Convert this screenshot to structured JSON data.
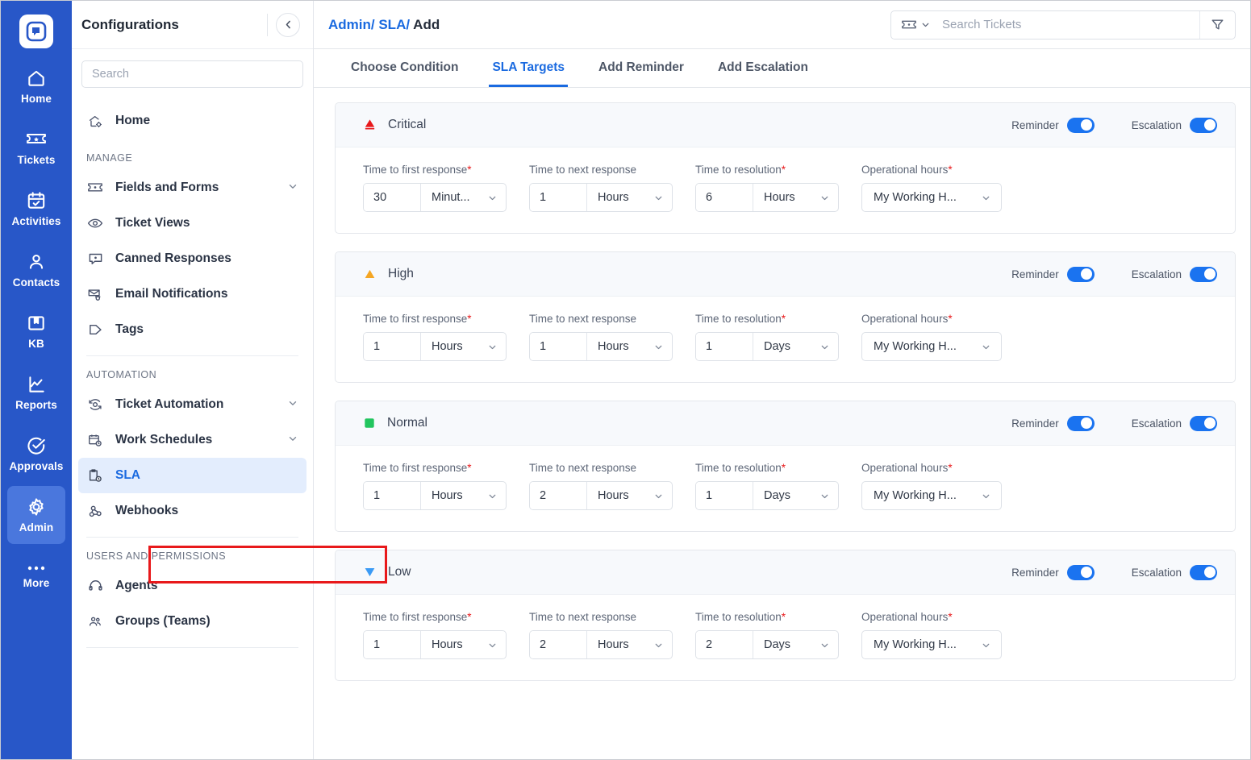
{
  "brand": {
    "logo": "chat-bubble-logo",
    "rail_bg": "#2857c8",
    "accent": "#1a6ae0"
  },
  "rail": {
    "items": [
      {
        "label": "Home",
        "icon": "home-icon",
        "active": false
      },
      {
        "label": "Tickets",
        "icon": "ticket-icon",
        "active": false
      },
      {
        "label": "Activities",
        "icon": "calendar-check-icon",
        "active": false
      },
      {
        "label": "Contacts",
        "icon": "person-icon",
        "active": false
      },
      {
        "label": "KB",
        "icon": "book-icon",
        "active": false
      },
      {
        "label": "Reports",
        "icon": "chart-icon",
        "active": false
      },
      {
        "label": "Approvals",
        "icon": "check-circle-icon",
        "active": false
      },
      {
        "label": "Admin",
        "icon": "gear-icon",
        "active": true
      },
      {
        "label": "More",
        "icon": "ellipsis-icon",
        "active": false
      }
    ]
  },
  "header": {
    "breadcrumb": {
      "admin": "Admin/",
      "sla": "SLA/",
      "current": "Add"
    },
    "search": {
      "placeholder": "Search Tickets",
      "value": "",
      "type_icon": "ticket-icon",
      "filter_icon": "filter-icon"
    }
  },
  "config_panel": {
    "title": "Configurations",
    "collapse_icon": "chevron-left-icon",
    "search": {
      "placeholder": "Search",
      "value": ""
    },
    "home_item": {
      "label": "Home",
      "icon": "home-gear-icon"
    },
    "sections": [
      {
        "label": "MANAGE",
        "items": [
          {
            "label": "Fields and Forms",
            "icon": "ticket-field-icon",
            "expandable": true,
            "selected": false
          },
          {
            "label": "Ticket Views",
            "icon": "eye-icon",
            "expandable": false,
            "selected": false
          },
          {
            "label": "Canned Responses",
            "icon": "message-icon",
            "expandable": false,
            "selected": false
          },
          {
            "label": "Email Notifications",
            "icon": "email-bell-icon",
            "expandable": false,
            "selected": false
          },
          {
            "label": "Tags",
            "icon": "tag-icon",
            "expandable": false,
            "selected": false
          }
        ]
      },
      {
        "label": "AUTOMATION",
        "items": [
          {
            "label": "Ticket Automation",
            "icon": "automation-icon",
            "expandable": true,
            "selected": false
          },
          {
            "label": "Work Schedules",
            "icon": "schedule-clock-icon",
            "expandable": true,
            "selected": false
          },
          {
            "label": "SLA",
            "icon": "sla-clock-icon",
            "expandable": false,
            "selected": true
          },
          {
            "label": "Webhooks",
            "icon": "webhook-icon",
            "expandable": false,
            "selected": false
          }
        ]
      },
      {
        "label": "USERS AND PERMISSIONS",
        "items": [
          {
            "label": "Agents",
            "icon": "headset-icon",
            "expandable": false,
            "selected": false
          },
          {
            "label": "Groups (Teams)",
            "icon": "people-icon",
            "expandable": false,
            "selected": false
          }
        ]
      }
    ]
  },
  "tabs": [
    {
      "label": "Choose Condition",
      "active": false
    },
    {
      "label": "SLA Targets",
      "active": true
    },
    {
      "label": "Add Reminder",
      "active": false
    },
    {
      "label": "Add Escalation",
      "active": false
    }
  ],
  "field_labels": {
    "first_response": "Time to first response",
    "next_response": "Time to next response",
    "resolution": "Time to resolution",
    "operational_hours": "Operational hours"
  },
  "toggle_labels": {
    "reminder": "Reminder",
    "escalation": "Escalation"
  },
  "sla_cards": [
    {
      "priority": "Critical",
      "priority_icon": "critical-cone-icon",
      "priority_color": "#e8191b",
      "reminder_on": true,
      "escalation_on": true,
      "first_response": {
        "value": "30",
        "unit": "Minut..."
      },
      "next_response": {
        "value": "1",
        "unit": "Hours"
      },
      "resolution": {
        "value": "6",
        "unit": "Hours"
      },
      "operational_hours": "My Working H..."
    },
    {
      "priority": "High",
      "priority_icon": "triangle-up-icon",
      "priority_color": "#f5a623",
      "reminder_on": true,
      "escalation_on": true,
      "first_response": {
        "value": "1",
        "unit": "Hours"
      },
      "next_response": {
        "value": "1",
        "unit": "Hours"
      },
      "resolution": {
        "value": "1",
        "unit": "Days"
      },
      "operational_hours": "My Working H..."
    },
    {
      "priority": "Normal",
      "priority_icon": "square-icon",
      "priority_color": "#22c55e",
      "reminder_on": true,
      "escalation_on": true,
      "first_response": {
        "value": "1",
        "unit": "Hours"
      },
      "next_response": {
        "value": "2",
        "unit": "Hours"
      },
      "resolution": {
        "value": "1",
        "unit": "Days"
      },
      "operational_hours": "My Working H..."
    },
    {
      "priority": "Low",
      "priority_icon": "triangle-down-icon",
      "priority_color": "#3b9bf5",
      "reminder_on": true,
      "escalation_on": true,
      "first_response": {
        "value": "1",
        "unit": "Hours"
      },
      "next_response": {
        "value": "2",
        "unit": "Hours"
      },
      "resolution": {
        "value": "2",
        "unit": "Days"
      },
      "operational_hours": "My Working H..."
    }
  ]
}
